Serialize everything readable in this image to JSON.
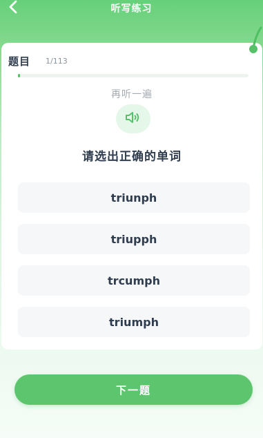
{
  "header": {
    "title": "听写练习",
    "back_icon": "chevron-left-icon"
  },
  "question": {
    "label": "题目",
    "count": "1/113",
    "progress_fraction": 0.00885
  },
  "audio": {
    "replay_label": "再听一遍",
    "speaker_icon": "speaker-icon"
  },
  "instruction": "请选出正确的单词",
  "options": [
    {
      "label": "triunph"
    },
    {
      "label": "triupph"
    },
    {
      "label": "trcumph"
    },
    {
      "label": "triumph"
    }
  ],
  "next_button": {
    "label": "下一题"
  },
  "colors": {
    "accent": "#5cc56e",
    "text_dark": "#2f3d4e",
    "text_muted": "#a4aab1",
    "option_bg": "#f5f7f9"
  }
}
